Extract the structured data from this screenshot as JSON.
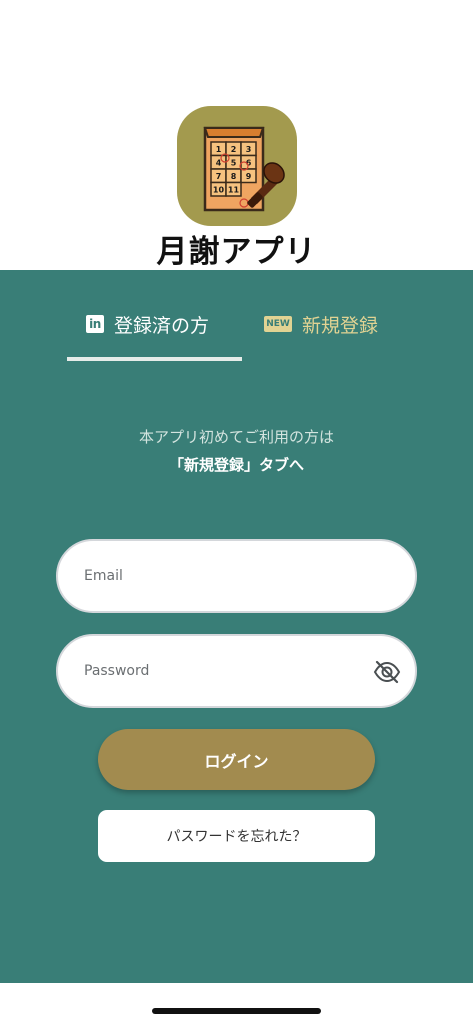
{
  "header": {
    "app_title": "月謝アプリ",
    "grid_numbers": [
      "1",
      "2",
      "3",
      "4",
      "5",
      "6",
      "7",
      "8",
      "9",
      "10",
      "11"
    ]
  },
  "tabs": {
    "login": {
      "label": "登録済の方",
      "icon": "linkedin-icon",
      "icon_text": "in",
      "active": true
    },
    "register": {
      "label": "新規登録",
      "icon": "new-badge-icon",
      "icon_text": "NEW",
      "active": false
    }
  },
  "info": {
    "line1": "本アプリ初めてご利用の方は",
    "line2": "「新規登録」タブへ"
  },
  "form": {
    "email_placeholder": "Email",
    "email_value": "",
    "password_placeholder": "Password",
    "password_value": "",
    "password_visibility_icon": "eye-off-icon",
    "login_label": "ログイン",
    "forgot_label": "パスワードを忘れた？"
  },
  "colors": {
    "panel": "#397e77",
    "login_button": "#a28b4f",
    "register_tab_text": "#e1d393",
    "icon_background": "#a39a4e"
  }
}
